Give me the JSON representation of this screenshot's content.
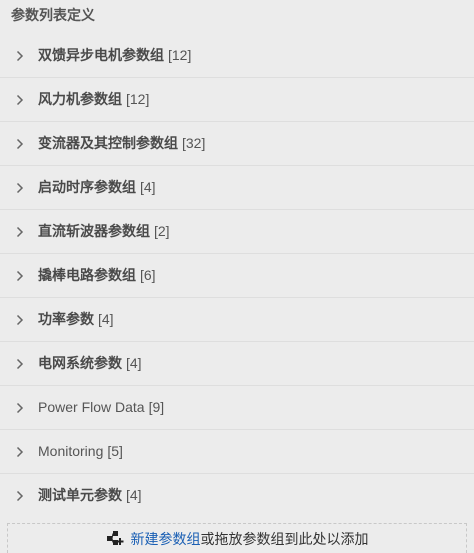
{
  "panel": {
    "title": "参数列表定义"
  },
  "groups": [
    {
      "name": "双馈异步电机参数组",
      "count": "[12]",
      "latin": false
    },
    {
      "name": "风力机参数组",
      "count": "[12]",
      "latin": false
    },
    {
      "name": "变流器及其控制参数组",
      "count": "[32]",
      "latin": false
    },
    {
      "name": "启动时序参数组",
      "count": "[4]",
      "latin": false
    },
    {
      "name": "直流斩波器参数组",
      "count": "[2]",
      "latin": false
    },
    {
      "name": "撬棒电路参数组",
      "count": "[6]",
      "latin": false
    },
    {
      "name": "功率参数",
      "count": "[4]",
      "latin": false
    },
    {
      "name": "电网系统参数",
      "count": "[4]",
      "latin": false
    },
    {
      "name": "Power Flow Data",
      "count": "[9]",
      "latin": true
    },
    {
      "name": "Monitoring",
      "count": "[5]",
      "latin": true
    },
    {
      "name": "测试单元参数",
      "count": "[4]",
      "latin": false
    }
  ],
  "footer": {
    "icon": "add-group-icon",
    "new_link": "新建参数组",
    "hint": "或拖放参数组到此处以添加"
  },
  "colors": {
    "background": "#ececec",
    "divider": "#dedede",
    "link": "#1a5fb4",
    "text": "#4a4a4a"
  }
}
